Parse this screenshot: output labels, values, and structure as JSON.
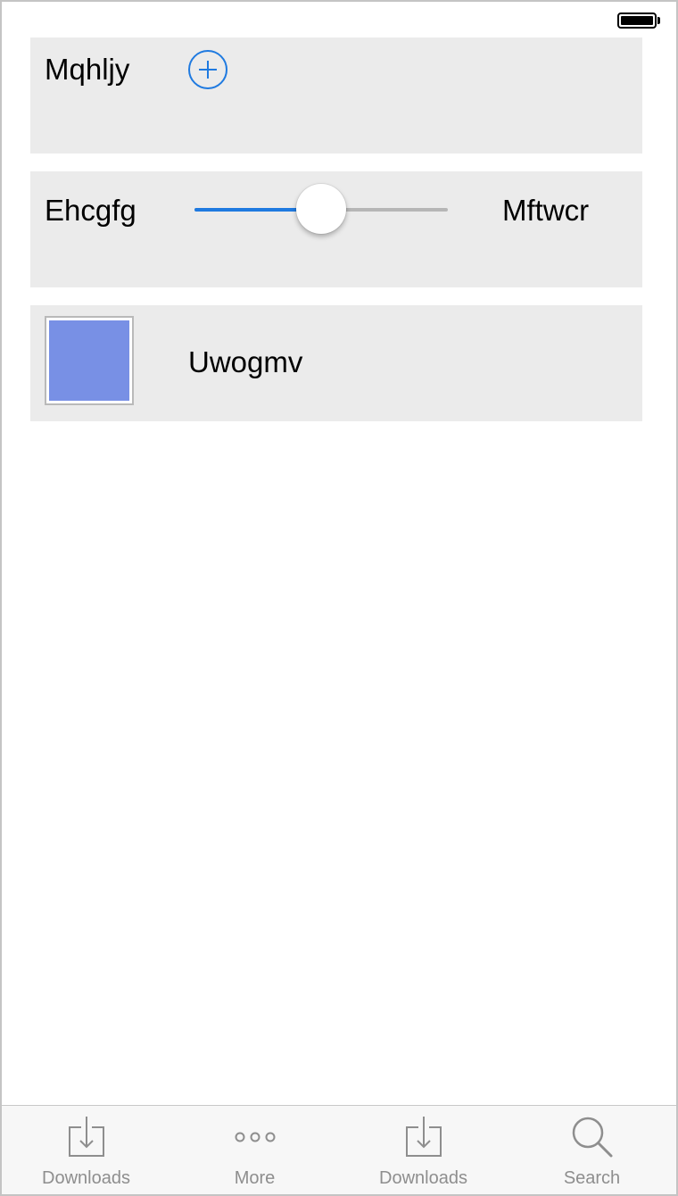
{
  "rows": {
    "add_row": {
      "label": "Mqhljy"
    },
    "slider_row": {
      "min_label": "Ehcgfg",
      "max_label": "Mftwcr",
      "value_fraction": 0.5,
      "accent_color": "#1f7ae0"
    },
    "color_row": {
      "label": "Uwogmv",
      "swatch_color": "#7890e5"
    }
  },
  "tab_bar": {
    "items": [
      {
        "label": "Downloads",
        "icon": "downloads-icon"
      },
      {
        "label": "More",
        "icon": "more-icon"
      },
      {
        "label": "Downloads",
        "icon": "downloads-icon"
      },
      {
        "label": "Search",
        "icon": "search-icon"
      }
    ]
  }
}
